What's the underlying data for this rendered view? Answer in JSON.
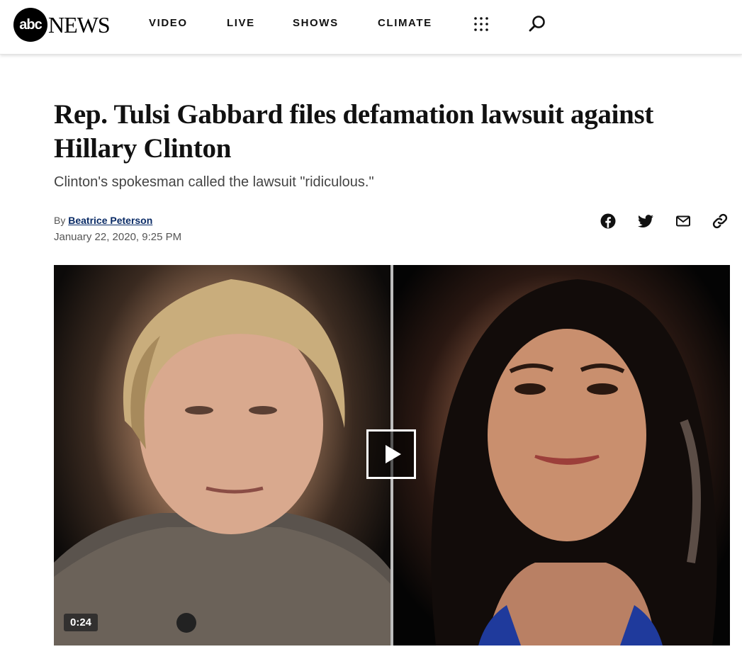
{
  "header": {
    "logo_mark": "abc",
    "logo_word": "NEWS",
    "nav": [
      {
        "label": "VIDEO"
      },
      {
        "label": "LIVE"
      },
      {
        "label": "SHOWS"
      },
      {
        "label": "CLIMATE"
      }
    ],
    "icons": [
      "grid-menu-icon",
      "search-icon"
    ]
  },
  "article": {
    "headline": "Rep. Tulsi Gabbard files defamation lawsuit against Hillary Clinton",
    "subhead": "Clinton's spokesman called the lawsuit \"ridiculous.\"",
    "by_prefix": "By",
    "author": "Beatrice Peterson",
    "date": "January 22, 2020, 9:25 PM",
    "share_icons": [
      "facebook-icon",
      "twitter-icon",
      "email-icon",
      "link-icon"
    ]
  },
  "video": {
    "duration": "0:24"
  },
  "colors": {
    "author_link": "#0a2b66",
    "text": "#111111",
    "muted": "#555555"
  }
}
